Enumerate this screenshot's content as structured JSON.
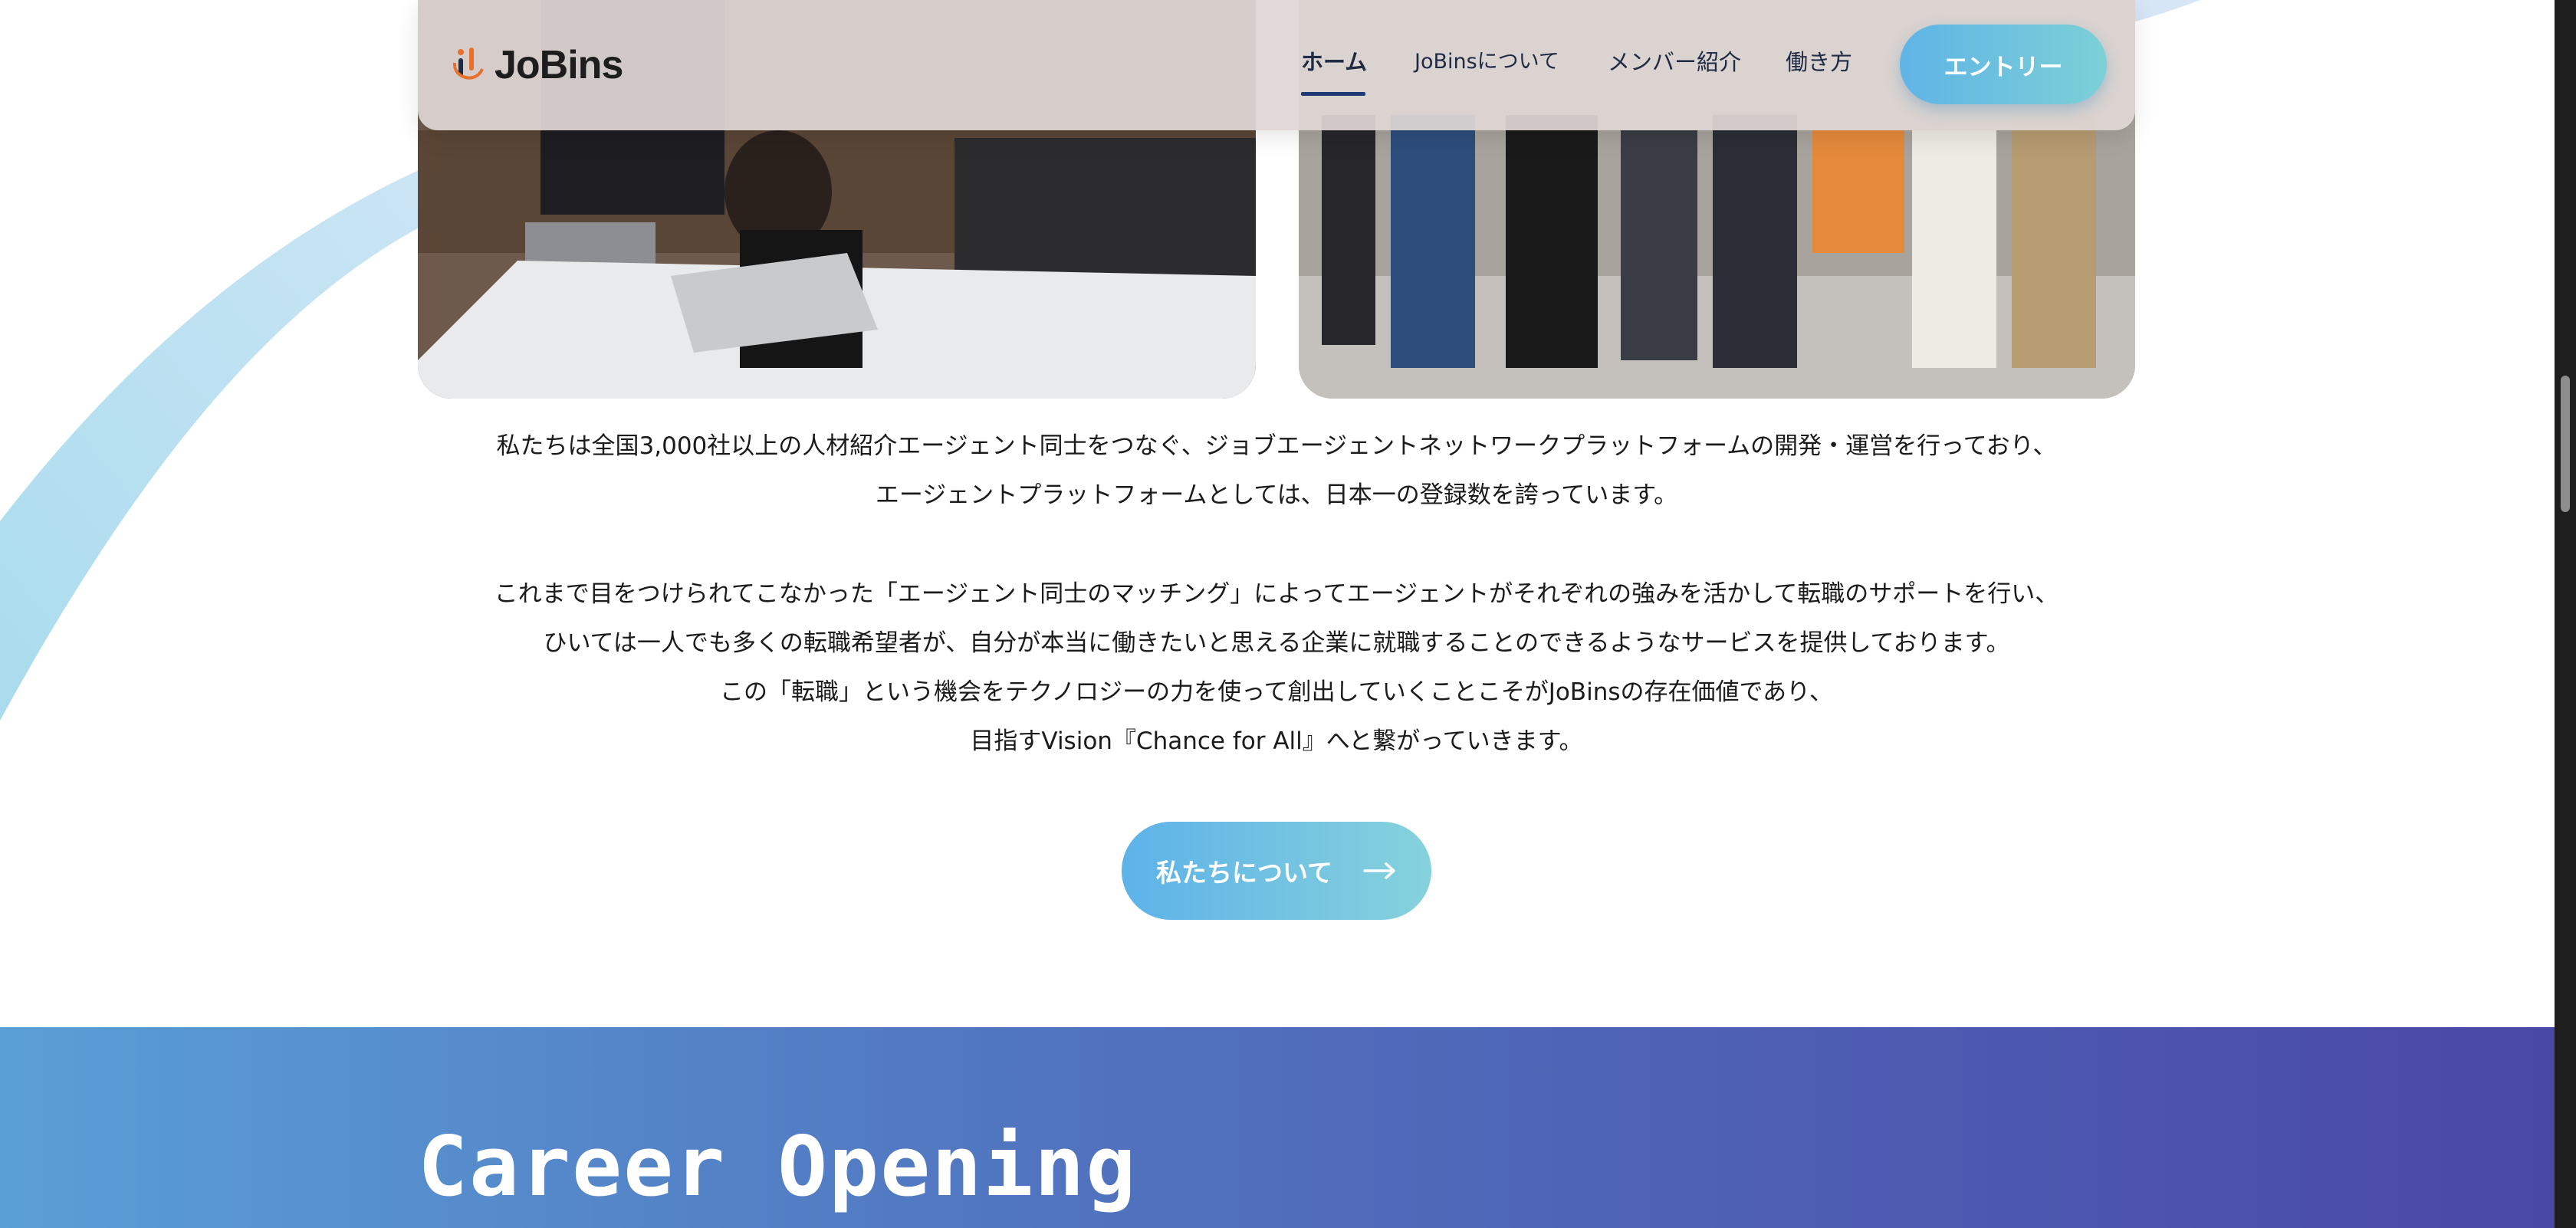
{
  "header": {
    "logo_text": "JoBins",
    "nav": {
      "home": "ホーム",
      "about": "JoBinsについて",
      "members": "メンバー紹介",
      "work": "働き方"
    },
    "entry_button": "エントリー"
  },
  "intro": {
    "paragraph1": [
      "私たちは全国3,000社以上の人材紹介エージェント同士をつなぐ、ジョブエージェントネットワークプラットフォームの開発・運営を行っており、",
      "エージェントプラットフォームとしては、日本一の登録数を誇っています。"
    ],
    "paragraph2": [
      "これまで目をつけられてこなかった「エージェント同士のマッチング」によってエージェントがそれぞれの強みを活かして転職のサポートを行い、",
      "ひいては一人でも多くの転職希望者が、自分が本当に働きたいと思える企業に就職することのできるようなサービスを提供しております。",
      "この「転職」という機会をテクノロジーの力を使って創出していくことこそがJoBinsの存在価値であり、",
      "目指すVision『Chance for All』へと繋がっていきます。"
    ],
    "about_button": "私たちについて",
    "about_button_icon": "arrow-right-icon"
  },
  "career": {
    "title": "Career Opening"
  },
  "colors": {
    "accent_gradient_start": "#5db2e8",
    "accent_gradient_end": "#86d2dc",
    "career_gradient_start": "#5a9fd6",
    "career_gradient_end": "#4a48a6",
    "logo_orange": "#e8702a"
  }
}
